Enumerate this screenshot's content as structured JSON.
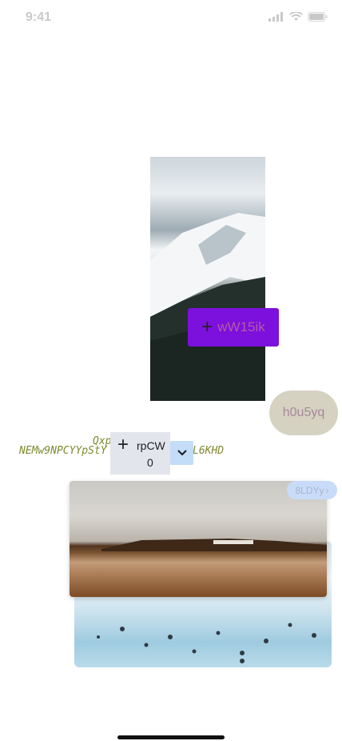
{
  "status_bar": {
    "time": "9:41",
    "icons": [
      "signal-icon",
      "wifi-icon",
      "battery-icon"
    ]
  },
  "images": {
    "mountain": "snowy mountain photo",
    "lake": "geothermal lagoon with bathers photo",
    "desert": "lakeshore landscape photo"
  },
  "purple_button": {
    "label": "wW15ik",
    "icon": "plus-icon",
    "bg": "#7c10dc"
  },
  "beige_pill": {
    "label": "h0u5yq"
  },
  "mono_text": {
    "line1": "Qxp",
    "line2": "NEMw9NPCYYpStY",
    "line3": "L6KHD"
  },
  "stepper_card": {
    "label": "rpCW",
    "value": "0",
    "icon": "plus-icon"
  },
  "dropdown": {
    "icon": "chevron-down-icon"
  },
  "blue_pill": {
    "label": "8LDYy",
    "icon": "chevron-right-icon"
  }
}
